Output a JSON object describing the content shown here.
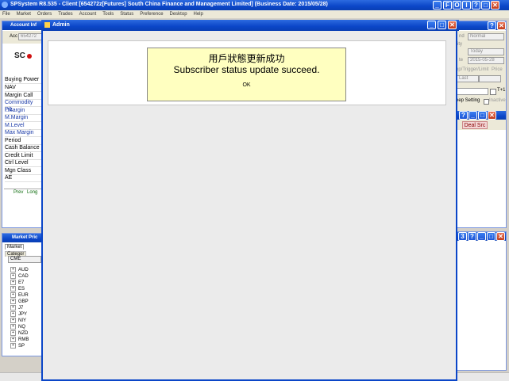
{
  "app": {
    "title": "SPSystem R8.535 - Client [654272z[Futures] South China Finance and Management Limited] (Business Date: 2015/05/28)",
    "menu": [
      "File",
      "Market",
      "Orders",
      "Trades",
      "Account",
      "Tools",
      "Status",
      "Preference",
      "Desktop",
      "Help"
    ],
    "top_buttons": [
      "F",
      "O",
      "I",
      "?"
    ]
  },
  "account_panel": {
    "title": "Account Inf",
    "acc_label": "Acc",
    "acc_value": "654272",
    "logo_text": "SC",
    "rows": [
      "Buying Power",
      "NAV",
      "Margin Call",
      "Commodity P/L",
      "I.Margin",
      "M.Margin",
      "M.Level",
      "Max Margin",
      "Period",
      "Cash Balance",
      "Credit Limit",
      "Ctrl Level",
      "Mgn Class",
      "AE"
    ],
    "tabs": [
      "Prev",
      "Long"
    ]
  },
  "market_panel": {
    "title": "Market Pric",
    "tabs": [
      "Market",
      "Categor"
    ],
    "exchange": "CME",
    "items": [
      "AUD",
      "CAD",
      "E7",
      "ES",
      "EUR",
      "GBP",
      "J7",
      "JPY",
      "NIY",
      "NQ",
      "NZD",
      "RMB",
      "SP"
    ]
  },
  "order_panel": {
    "cond_label": "nd",
    "cond_value": "Normal",
    "validity_label": "ity",
    "validity_value": "Today",
    "date_label": "te",
    "date_value": "2015-05-28",
    "stop_label": "op/Trigger/Limit",
    "price_label": "Price",
    "level_value": "Last",
    "t1_label": "T+1",
    "keep_label": "eep Setting",
    "inactive_label": "Inactive",
    "deal_src": "Deal Src"
  },
  "right_lower": {
    "btn_label": "3",
    "help_label": "?"
  },
  "admin_window": {
    "title": "Admin"
  },
  "dialog": {
    "message_zh": "用戶狀態更新成功",
    "message_en": "Subscriber status update succeed.",
    "ok_label": "OK"
  },
  "colors": {
    "title_blue": "#0b46c8",
    "message_bg": "#ffffc0",
    "close_red": "#c23a1a"
  }
}
